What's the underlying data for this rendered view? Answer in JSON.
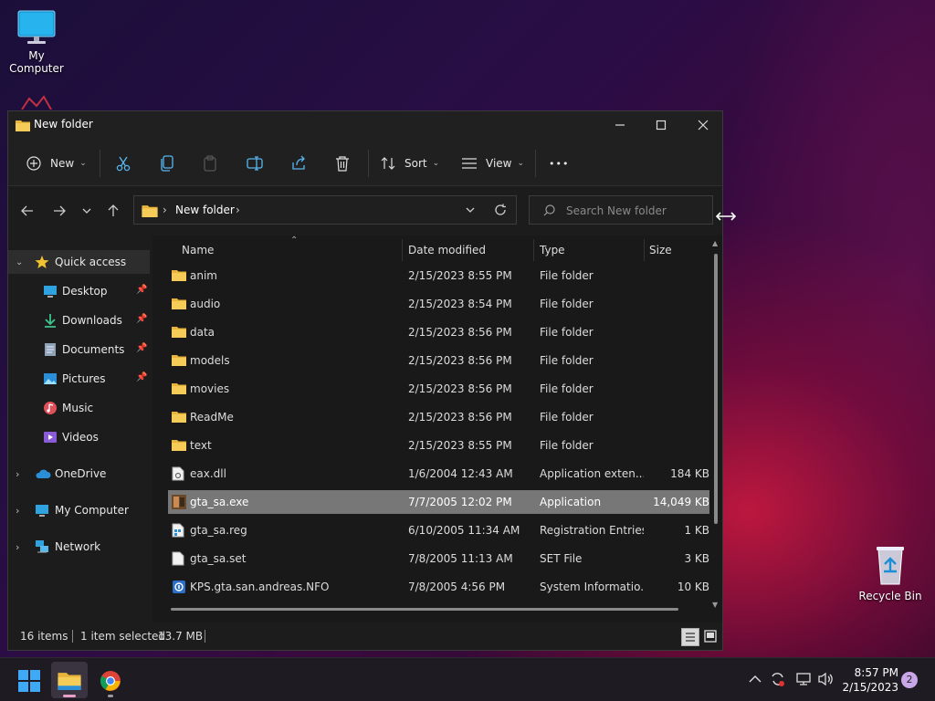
{
  "desktop": {
    "my_computer_label": "My Computer",
    "recycle_bin_label": "Recycle Bin"
  },
  "window": {
    "title": "New folder",
    "controls": {
      "minimize": "—",
      "maximize": "☐",
      "close": "✕"
    }
  },
  "toolbar": {
    "new_label": "New",
    "sort_label": "Sort",
    "view_label": "View",
    "more_label": "•••"
  },
  "address": {
    "path_segment": "New folder",
    "search_placeholder": "Search New folder"
  },
  "sidebar": {
    "quick_access": "Quick access",
    "items": [
      {
        "label": "Desktop",
        "icon": "desktop-icon",
        "pinned": true
      },
      {
        "label": "Downloads",
        "icon": "downloads-icon",
        "pinned": true
      },
      {
        "label": "Documents",
        "icon": "documents-icon",
        "pinned": true
      },
      {
        "label": "Pictures",
        "icon": "pictures-icon",
        "pinned": true
      },
      {
        "label": "Music",
        "icon": "music-icon",
        "pinned": false
      },
      {
        "label": "Videos",
        "icon": "videos-icon",
        "pinned": false
      }
    ],
    "onedrive": "OneDrive",
    "my_computer": "My Computer",
    "network": "Network"
  },
  "columns": {
    "name": "Name",
    "date": "Date modified",
    "type": "Type",
    "size": "Size"
  },
  "files": [
    {
      "name": "anim",
      "date": "2/15/2023 8:55 PM",
      "type": "File folder",
      "size": "",
      "kind": "folder"
    },
    {
      "name": "audio",
      "date": "2/15/2023 8:54 PM",
      "type": "File folder",
      "size": "",
      "kind": "folder"
    },
    {
      "name": "data",
      "date": "2/15/2023 8:56 PM",
      "type": "File folder",
      "size": "",
      "kind": "folder"
    },
    {
      "name": "models",
      "date": "2/15/2023 8:56 PM",
      "type": "File folder",
      "size": "",
      "kind": "folder"
    },
    {
      "name": "movies",
      "date": "2/15/2023 8:56 PM",
      "type": "File folder",
      "size": "",
      "kind": "folder"
    },
    {
      "name": "ReadMe",
      "date": "2/15/2023 8:56 PM",
      "type": "File folder",
      "size": "",
      "kind": "folder"
    },
    {
      "name": "text",
      "date": "2/15/2023 8:55 PM",
      "type": "File folder",
      "size": "",
      "kind": "folder"
    },
    {
      "name": "eax.dll",
      "date": "1/6/2004 12:43 AM",
      "type": "Application exten...",
      "size": "184 KB",
      "kind": "dll"
    },
    {
      "name": "gta_sa.exe",
      "date": "7/7/2005 12:02 PM",
      "type": "Application",
      "size": "14,049 KB",
      "kind": "exe",
      "selected": true
    },
    {
      "name": "gta_sa.reg",
      "date": "6/10/2005 11:34 AM",
      "type": "Registration Entries",
      "size": "1 KB",
      "kind": "reg"
    },
    {
      "name": "gta_sa.set",
      "date": "7/8/2005 11:13 AM",
      "type": "SET File",
      "size": "3 KB",
      "kind": "file"
    },
    {
      "name": "KPS.gta.san.andreas.NFO",
      "date": "7/8/2005 4:56 PM",
      "type": "System Informatio...",
      "size": "10 KB",
      "kind": "nfo"
    }
  ],
  "status": {
    "item_count": "16 items",
    "selection": "1 item selected",
    "selection_size": "13.7 MB"
  },
  "taskbar": {
    "time": "8:57 PM",
    "date": "2/15/2023",
    "notification_count": "2"
  },
  "colors": {
    "accent": "#4cc2ff",
    "folder": "#f0c14b",
    "selected_row": "#777777"
  }
}
